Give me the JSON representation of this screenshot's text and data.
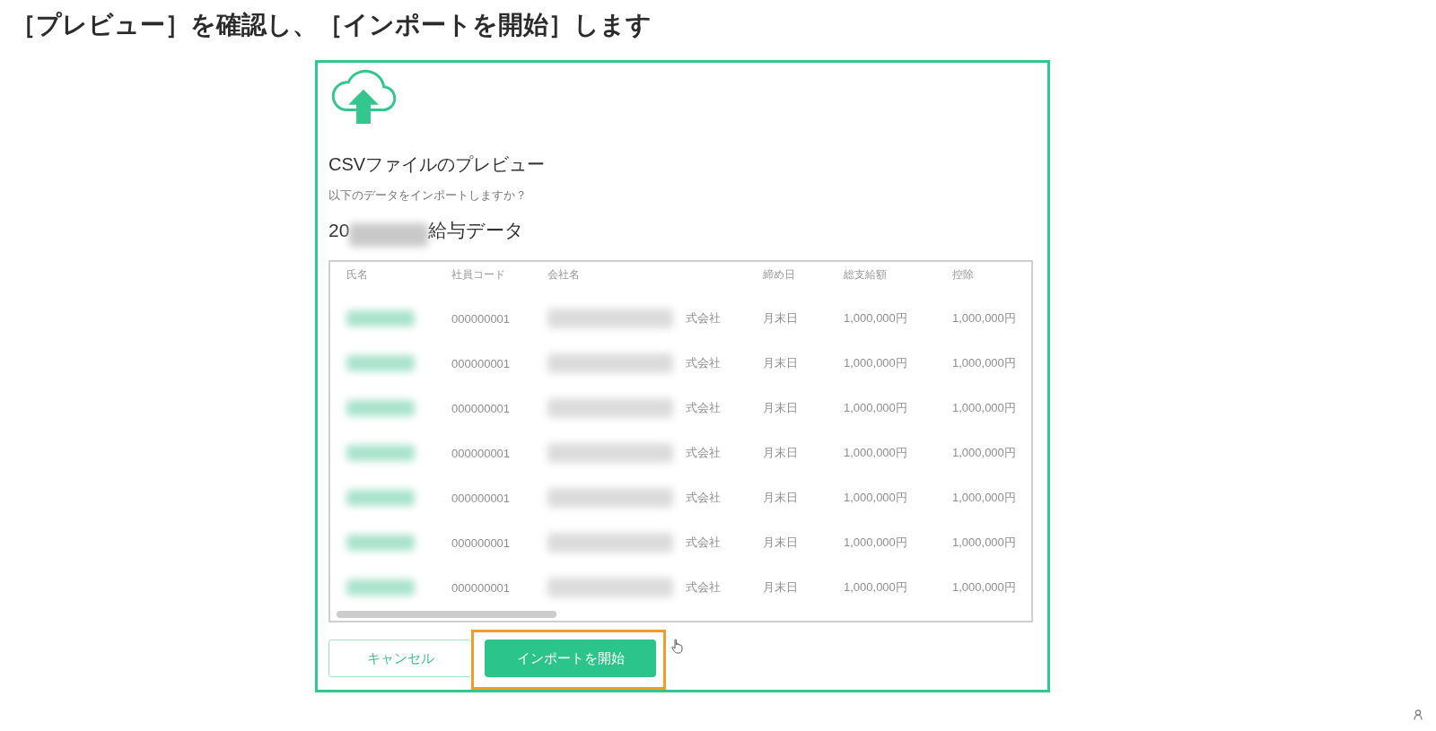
{
  "heading": "［プレビュー］を確認し、［インポートを開始］します",
  "dialog": {
    "title": "CSVファイルのプレビュー",
    "prompt": "以下のデータをインポートしますか？",
    "data_title": {
      "prefix": "20",
      "redacted": true,
      "suffix": "給与データ"
    }
  },
  "table": {
    "columns": [
      "氏名",
      "社員コード",
      "会社名",
      "締め日",
      "総支給額",
      "控除"
    ],
    "rows": [
      {
        "name_redacted": true,
        "code": "000000001",
        "company_redacted": true,
        "company": "式会社",
        "closing_day": "月末日",
        "gross_pay": "1,000,000円",
        "deduction": "1,000,000円"
      },
      {
        "name_redacted": true,
        "code": "000000001",
        "company_redacted": true,
        "company": "式会社",
        "closing_day": "月末日",
        "gross_pay": "1,000,000円",
        "deduction": "1,000,000円"
      },
      {
        "name_redacted": true,
        "code": "000000001",
        "company_redacted": true,
        "company": "式会社",
        "closing_day": "月末日",
        "gross_pay": "1,000,000円",
        "deduction": "1,000,000円"
      },
      {
        "name_redacted": true,
        "code": "000000001",
        "company_redacted": true,
        "company": "式会社",
        "closing_day": "月末日",
        "gross_pay": "1,000,000円",
        "deduction": "1,000,000円"
      },
      {
        "name_redacted": true,
        "code": "000000001",
        "company_redacted": true,
        "company": "式会社",
        "closing_day": "月末日",
        "gross_pay": "1,000,000円",
        "deduction": "1,000,000円"
      },
      {
        "name_redacted": true,
        "code": "000000001",
        "company_redacted": true,
        "company": "式会社",
        "closing_day": "月末日",
        "gross_pay": "1,000,000円",
        "deduction": "1,000,000円"
      },
      {
        "name_redacted": true,
        "code": "000000001",
        "company_redacted": true,
        "company": "式会社",
        "closing_day": "月末日",
        "gross_pay": "1,000,000円",
        "deduction": "1,000,000円"
      }
    ]
  },
  "buttons": [
    {
      "label": "キャンセル",
      "kind": "secondary",
      "highlighted": false
    },
    {
      "label": "インポートを開始",
      "kind": "primary",
      "highlighted": true
    }
  ]
}
